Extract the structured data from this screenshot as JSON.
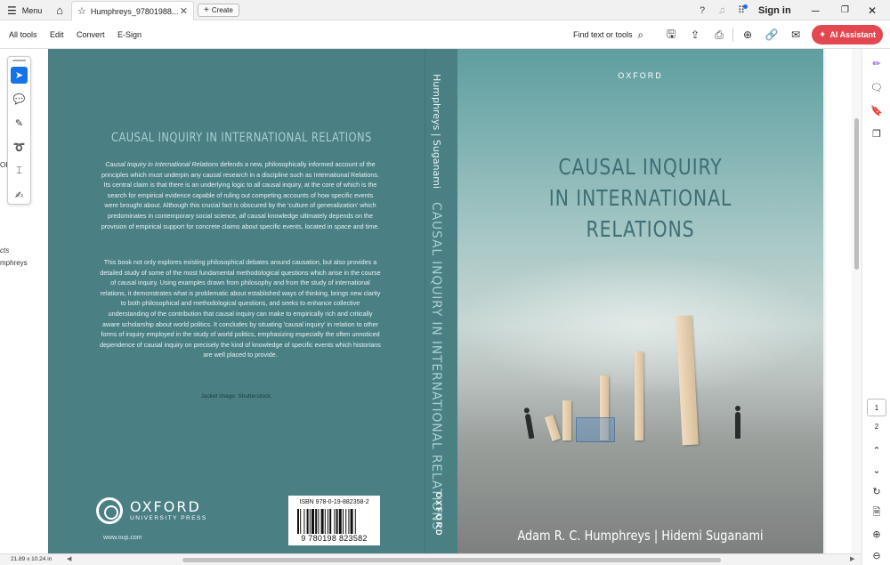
{
  "titlebar": {
    "menu_label": "Menu",
    "active_tab_label": "Humphreys_97801988...",
    "create_label": "Create",
    "signin_label": "Sign in",
    "menu_icon": "hamburger-icon",
    "home_icon": "home-icon",
    "help_icon": "help-icon",
    "bell_icon": "bell-icon",
    "apps_icon": "apps-icon"
  },
  "toolbar": {
    "all_tools": "All tools",
    "edit": "Edit",
    "convert": "Convert",
    "esign": "E-Sign",
    "find": "Find text or tools",
    "ai_assistant": "AI Assistant",
    "ai_color": "#e34850"
  },
  "canvas": {
    "ghost_1": "OF",
    "ghost_2": "cts",
    "ghost_3": "mphreys"
  },
  "book": {
    "back": {
      "title": "CAUSAL INQUIRY IN INTERNATIONAL RELATIONS",
      "blurb_1_italic": "Causal Inquiry in International Relations",
      "blurb_1_a": " defends a new, philosophically informed account of the principles which must underpin any causal research in a discipline such as International Relations. Its central claim is that there is an underlying logic to all causal inquiry, at the core of which is the search for empirical evidence capable of ruling out competing accounts of how specific events were brought about.  Although this crucial fact is obscured by the 'culture of generalization' which predominates in contemporary social science, ",
      "blurb_1_all": "all",
      "blurb_1_b": " causal knowledge ultimately depends on the provision of empirical support for concrete claims about specific events, located in space and time.",
      "blurb_2": "This book not only explores existing philosophical debates around causation, but also provides a detailed study of some of the most fundamental methodological questions which arise in the course of causal inquiry.  Using examples drawn from philosophy and from the study of international relations, it demonstrates what is problematic about established ways of thinking, brings new clarity to both philosophical and methodological questions, and seeks to enhance collective understanding of the contribution that causal inquiry can make to empirically rich and critically aware scholarship about world politics.  It concludes by situating 'causal inquiry' in relation to other forms of inquiry employed in the study of world politics, emphasizing especially the often unnoticed dependence of causal inquiry on precisely the kind of knowledge of specific events which historians are well placed to provide.",
      "jacket": "Jacket image: Shutterstock.",
      "publisher": "OXFORD",
      "publisher_sub": "UNIVERSITY PRESS",
      "url": "www.oup.com",
      "isbn": "ISBN 978-0-19-882358-2",
      "barcode_number": "9 780198 823582"
    },
    "spine": {
      "authors": "Humphreys  |  Suganami",
      "title": "CAUSAL INQUIRY IN INTERNATIONAL RELATIONS",
      "publisher": "OXFORD"
    },
    "front": {
      "publisher": "OXFORD",
      "title_line_1": "CAUSAL INQUIRY",
      "title_line_2": "IN INTERNATIONAL",
      "title_line_3": "RELATIONS",
      "authors": "Adam R. C. Humphreys  |  Hidemi Suganami"
    },
    "cover_color": "#4a7f84"
  },
  "right_rail": {
    "current_page": "1",
    "total_pages": "2"
  },
  "statusbar": {
    "page_size": "21.89 x 10.24 in"
  }
}
